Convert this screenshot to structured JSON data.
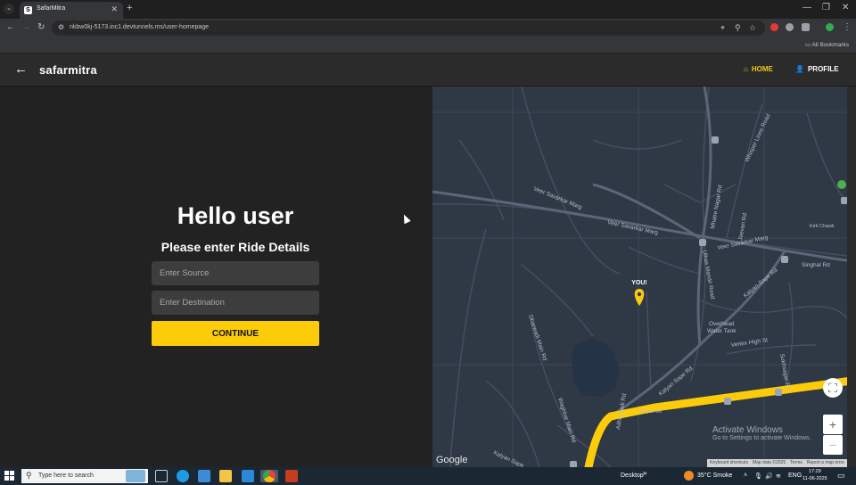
{
  "browser": {
    "tab_title": "SafarMitra",
    "tab_favicon_letter": "S",
    "url": "nkbw0kj-5173.inc1.devtunnels.ms/user-homepage",
    "bookmarks_label": "All Bookmarks"
  },
  "app": {
    "brand": "safarmitra",
    "nav": {
      "home": "HOME",
      "profile": "PROFILE"
    },
    "accent_color": "#fccc0a"
  },
  "form": {
    "greeting": "Hello user",
    "subtitle": "Please enter Ride Details",
    "source_placeholder": "Enter Source",
    "destination_placeholder": "Enter Destination",
    "continue_label": "CONTINUE"
  },
  "map": {
    "marker_label": "YOU!",
    "google_logo": "Google",
    "labels": {
      "veer1": "Veer Savarkar Marg",
      "veer2": "Veer Savarkar Marg",
      "veer3": "Veer Savarkar Marg",
      "ulhas": "Ulhas Mandir Road",
      "whisper": "Whisper Lions Road",
      "mhatre": "Mhatre Nagar Rd",
      "kalyan1": "Kalyan-Sape Rd",
      "kalyan2": "Kalyan Sape Rd",
      "singhal": "Singhal Rd",
      "overhead": "Overhead",
      "water_tank": "Water Tank",
      "vertex": "Vertex High St",
      "kirti": "Kirti Chawk",
      "jeevan": "Jeevan Rd",
      "sukhsagar": "Sukhsagar Rd",
      "adharwadi": "Adharwadi Rd",
      "bhaujan": "Wadegaon Main Rd",
      "kalyan_dk": "Kalyan Dk",
      "dhanwadi": "Dharwadi Main Rd",
      "waghbar": "Waghbar Main Rd",
      "kalyan3": "Kalyan Sape"
    },
    "attribution": [
      "Keyboard shortcuts",
      "Map data ©2025",
      "Terms",
      "Report a map error"
    ],
    "zoom_in": "+",
    "zoom_out": "−",
    "watermark_title": "Activate Windows",
    "watermark_sub": "Go to Settings to activate Windows."
  },
  "taskbar": {
    "search_placeholder": "Type here to search",
    "desktop_label": "Desktop",
    "weather": "35°C  Smoke",
    "language": "ENG",
    "time": "17:29",
    "date": "11-06-2025"
  }
}
